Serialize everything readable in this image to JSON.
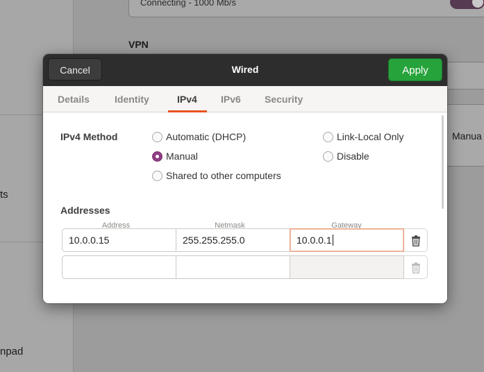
{
  "background": {
    "status_text": "Connecting - 1000 Mb/s",
    "vpn_label": "VPN",
    "sidebar_items": [
      "ts",
      "npad"
    ],
    "right_value": "Manua"
  },
  "dialog": {
    "title": "Wired",
    "cancel_label": "Cancel",
    "apply_label": "Apply",
    "tabs": [
      {
        "label": "Details",
        "active": false
      },
      {
        "label": "Identity",
        "active": false
      },
      {
        "label": "IPv4",
        "active": true
      },
      {
        "label": "IPv6",
        "active": false
      },
      {
        "label": "Security",
        "active": false
      }
    ],
    "ipv4_method": {
      "label": "IPv4 Method",
      "options": {
        "automatic": "Automatic (DHCP)",
        "manual": "Manual",
        "shared": "Shared to other computers",
        "link_local": "Link-Local Only",
        "disable": "Disable"
      },
      "selected": "Manual"
    },
    "addresses": {
      "label": "Addresses",
      "columns": [
        "Address",
        "Netmask",
        "Gateway"
      ],
      "rows": [
        {
          "address": "10.0.0.15",
          "netmask": "255.255.255.0",
          "gateway": "10.0.0.1"
        },
        {
          "address": "",
          "netmask": "",
          "gateway": ""
        }
      ]
    }
  },
  "colors": {
    "apply_green": "#26a33b",
    "header_dark": "#2d2d2d",
    "tab_accent": "#e95420",
    "radio_checked": "#8f3d84"
  },
  "icons": [
    "trash-icon"
  ]
}
